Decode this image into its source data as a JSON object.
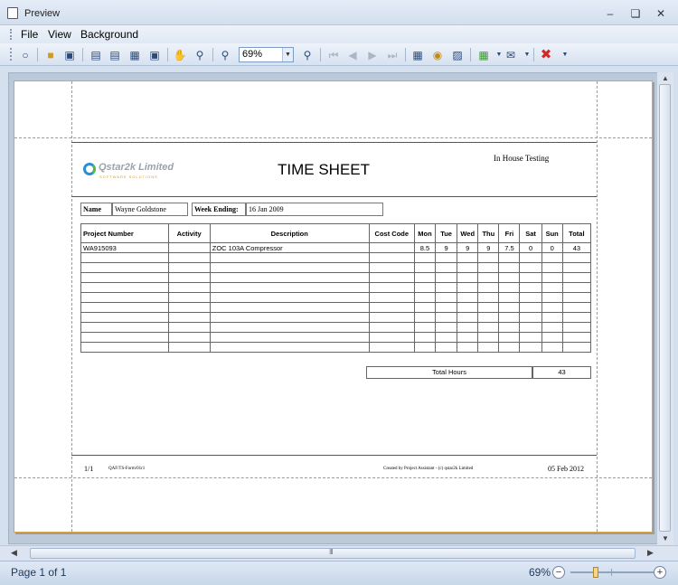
{
  "window": {
    "title": "Preview",
    "minimize_icon": "minimize-icon",
    "restore_icon": "restore-icon",
    "close_icon": "close-icon"
  },
  "menu": {
    "file": "File",
    "view": "View",
    "background": "Background"
  },
  "toolbar": {
    "zoom_value": "69%"
  },
  "document": {
    "logo_text": "Qstar2k Limited",
    "logo_tagline": "SOFTWARE SOLUTIONS",
    "title": "TIME SHEET",
    "subtitle": "In House Testing",
    "name_label": "Name",
    "name_value": "Wayne Goldstone",
    "week_label": "Week Ending:",
    "week_value": "16 Jan 2009",
    "columns": [
      "Project Number",
      "Activity",
      "Description",
      "Cost Code",
      "Mon",
      "Tue",
      "Wed",
      "Thu",
      "Fri",
      "Sat",
      "Sun",
      "Total"
    ],
    "rows": [
      [
        "WA915093",
        "",
        "ZOC 103A Compressor",
        "",
        "8.5",
        "9",
        "9",
        "9",
        "7.5",
        "0",
        "0",
        "43"
      ]
    ],
    "total_label": "Total Hours",
    "total_value": "43",
    "footer": {
      "page": "1/1",
      "form_code": "QAF/TS-Form/01r1",
      "created_by": "Created by Project Assistant - (c) qstar2k Limited",
      "date": "05 Feb 2012"
    }
  },
  "status": {
    "page_info": "Page 1 of 1",
    "zoom": "69%"
  }
}
